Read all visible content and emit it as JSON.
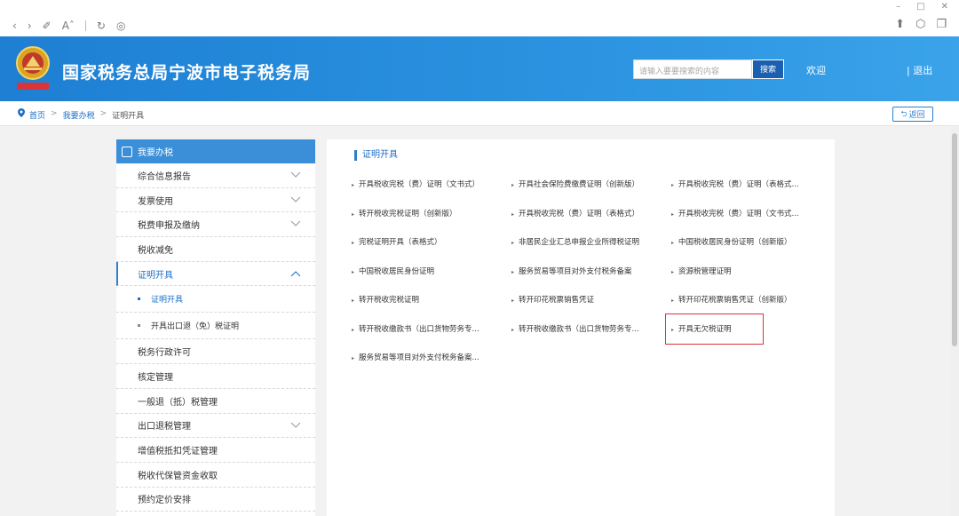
{
  "header": {
    "site_title": "国家税务总局宁波市电子税务局",
    "search_placeholder": "请输入要要搜索的内容",
    "search_button": "搜索",
    "welcome": "欢迎",
    "logout": "| 退出"
  },
  "breadcrumb": {
    "items": [
      "首页",
      "我要办税",
      "证明开具"
    ],
    "separator": ">",
    "back_label": "返回"
  },
  "sidebar": {
    "heading": "我要办税",
    "items": [
      {
        "label": "综合信息报告"
      },
      {
        "label": "发票使用"
      },
      {
        "label": "税费申报及缴纳"
      },
      {
        "label": "税收减免"
      },
      {
        "label": "证明开具"
      },
      {
        "label": "证明开具"
      },
      {
        "label": "开具出口退（免）税证明"
      },
      {
        "label": "税务行政许可"
      },
      {
        "label": "核定管理"
      },
      {
        "label": "一般退（抵）税管理"
      },
      {
        "label": "出口退税管理"
      },
      {
        "label": "增值税抵扣凭证管理"
      },
      {
        "label": "税收代保管资金收取"
      },
      {
        "label": "预约定价安排"
      }
    ]
  },
  "panel": {
    "title": "证明开具",
    "links": [
      "开具税收完税（费）证明（文书式）",
      "开具社会保险费缴费证明（创新版）",
      "开具税收完税（费）证明（表格式...",
      "转开税收完税证明（创新版）",
      "开具税收完税（费）证明（表格式）",
      "开具税收完税（费）证明（文书式...",
      "完税证明开具（表格式）",
      "非居民企业汇总申报企业所得税证明",
      "中国税收居民身份证明（创新版）",
      "中国税收居民身份证明",
      "服务贸易等项目对外支付税务备案",
      "资源税管理证明",
      "转开税收完税证明",
      "转开印花税票销售凭证",
      "转开印花税票销售凭证（创新版）",
      "转开税收缴款书（出口货物劳务专...",
      "转开税收缴款书（出口货物劳务专...",
      "开具无欠税证明",
      "服务贸易等项目对外支付税务备案..."
    ]
  },
  "colors": {
    "header_blue": "#2b93e0",
    "accent": "#1e6ec7",
    "highlight_red": "#d9343a"
  }
}
